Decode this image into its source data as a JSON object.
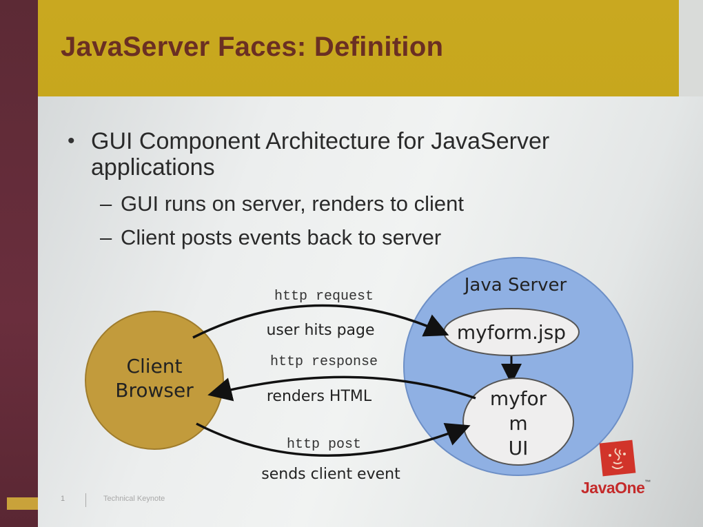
{
  "slide": {
    "title": "JavaServer Faces: Definition",
    "bullet_symbol": "•",
    "bullet": "GUI Component Architecture for JavaServer applications",
    "sub_bullets": [
      "GUI runs on server, renders to client",
      "Client posts events back to server"
    ],
    "sub_bullet_symbol": "–"
  },
  "diagram": {
    "client": {
      "line1": "Client",
      "line2": "Browser"
    },
    "server": {
      "label": "Java Server"
    },
    "jsp_node": "myform.jsp",
    "ui_node": {
      "line1": "myfor",
      "line2": "m",
      "line3": "UI"
    },
    "arrows": {
      "request": {
        "code": "http request",
        "desc": "user hits page"
      },
      "response": {
        "code": "http response",
        "desc": "renders HTML"
      },
      "post": {
        "code": "http post",
        "desc": "sends client event"
      }
    },
    "colors": {
      "client_fill": "#c29b3c",
      "server_fill": "#8fb0e3",
      "node_fill": "#efeeee"
    }
  },
  "footer": {
    "page_number": "1",
    "section": "Technical Keynote"
  },
  "logo": {
    "icon": "javaone-cup-icon",
    "text": "JavaOne",
    "trademark": "™"
  }
}
